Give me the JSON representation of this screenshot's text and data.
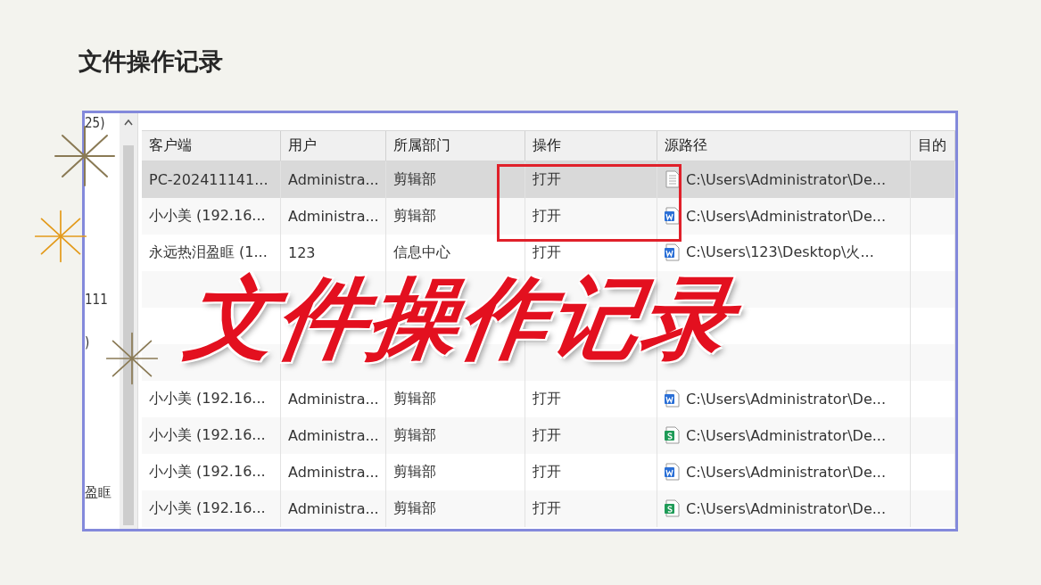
{
  "slide": {
    "title": "文件操作记录",
    "overlay_caption": "文件操作记录"
  },
  "side_panel": {
    "items": [
      "25)",
      "111",
      ")",
      "盈眶"
    ]
  },
  "table": {
    "columns": [
      "客户端",
      "用户",
      "所属部门",
      "操作",
      "源路径",
      "目的"
    ],
    "rows": [
      {
        "client": "PC-202411141...",
        "user": "Administra...",
        "department": "剪辑部",
        "action": "打开",
        "path": "C:\\Users\\Administrator\\De...",
        "kind": "text",
        "selected": true
      },
      {
        "client": "小小美 (192.16...",
        "user": "Administra...",
        "department": "剪辑部",
        "action": "打开",
        "path": "C:\\Users\\Administrator\\De...",
        "kind": "word",
        "selected": false
      },
      {
        "client": "永远热泪盈眶 (1...",
        "user": "123",
        "department": "信息中心",
        "action": "打开",
        "path": "C:\\Users\\123\\Desktop\\火...",
        "kind": "word",
        "selected": false
      },
      {
        "selected": false
      },
      {
        "selected": false
      },
      {
        "selected": false
      },
      {
        "client": "小小美 (192.16...",
        "user": "Administra...",
        "department": "剪辑部",
        "action": "打开",
        "path": "C:\\Users\\Administrator\\De...",
        "kind": "word",
        "selected": false
      },
      {
        "client": "小小美 (192.16...",
        "user": "Administra...",
        "department": "剪辑部",
        "action": "打开",
        "path": "C:\\Users\\Administrator\\De...",
        "kind": "sheet",
        "selected": false
      },
      {
        "client": "小小美 (192.16...",
        "user": "Administra...",
        "department": "剪辑部",
        "action": "打开",
        "path": "C:\\Users\\Administrator\\De...",
        "kind": "word",
        "selected": false
      },
      {
        "client": "小小美 (192.16...",
        "user": "Administra...",
        "department": "剪辑部",
        "action": "打开",
        "path": "C:\\Users\\Administrator\\De...",
        "kind": "sheet",
        "selected": false
      }
    ]
  }
}
